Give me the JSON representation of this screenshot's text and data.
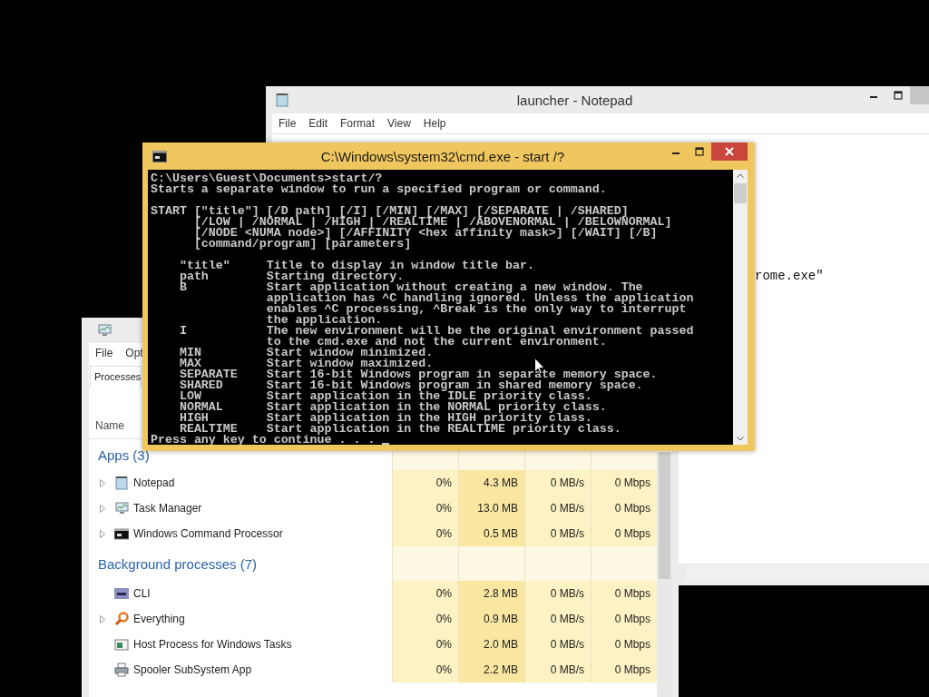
{
  "notepad": {
    "title": "launcher - Notepad",
    "menu": [
      "File",
      "Edit",
      "Format",
      "View",
      "Help"
    ],
    "text": "rome.exe\""
  },
  "task_manager": {
    "menu": [
      "File",
      "Opt"
    ],
    "tabs": [
      {
        "label": "Processes",
        "selected": true
      }
    ],
    "columns": [
      "Name"
    ],
    "groups": [
      {
        "title": "Apps (3)",
        "rows": [
          {
            "name": "Notepad",
            "kind": "notepad",
            "expandable": true,
            "cpu": "0%",
            "memory": "4.3 MB",
            "disk": "0 MB/s",
            "network": "0 Mbps"
          },
          {
            "name": "Task Manager",
            "kind": "monitor",
            "expandable": true,
            "cpu": "0%",
            "memory": "13.0 MB",
            "disk": "0 MB/s",
            "network": "0 Mbps"
          },
          {
            "name": "Windows Command Processor",
            "kind": "console",
            "expandable": true,
            "cpu": "0%",
            "memory": "0.5 MB",
            "disk": "0 MB/s",
            "network": "0 Mbps"
          }
        ]
      },
      {
        "title": "Background processes (7)",
        "rows": [
          {
            "name": "CLI",
            "kind": "php",
            "expandable": false,
            "cpu": "0%",
            "memory": "2.8 MB",
            "disk": "0 MB/s",
            "network": "0 Mbps"
          },
          {
            "name": "Everything",
            "kind": "magnifier",
            "expandable": true,
            "cpu": "0%",
            "memory": "0.9 MB",
            "disk": "0 MB/s",
            "network": "0 Mbps"
          },
          {
            "name": "Host Process for Windows Tasks",
            "kind": "window",
            "expandable": false,
            "cpu": "0%",
            "memory": "2.0 MB",
            "disk": "0 MB/s",
            "network": "0 Mbps"
          },
          {
            "name": "Spooler SubSystem App",
            "kind": "printer",
            "expandable": false,
            "cpu": "0%",
            "memory": "2.2 MB",
            "disk": "0 MB/s",
            "network": "0 Mbps"
          }
        ]
      }
    ]
  },
  "cmd": {
    "title": "C:\\Windows\\system32\\cmd.exe - start /?",
    "blocks": [
      [
        "C:\\Users\\Guest\\Documents>start/?",
        "Starts a separate window to run a specified program or command."
      ],
      [
        "START [\"title\"] [/D path] [/I] [/MIN] [/MAX] [/SEPARATE | /SHARED]",
        "      [/LOW | /NORMAL | /HIGH | /REALTIME | /ABOVENORMAL | /BELOWNORMAL]",
        "      [/NODE <NUMA node>] [/AFFINITY <hex affinity mask>] [/WAIT] [/B]",
        "      [command/program] [parameters]"
      ],
      [
        "    \"title\"     Title to display in window title bar.",
        "    path        Starting directory.",
        "    B           Start application without creating a new window. The",
        "                application has ^C handling ignored. Unless the application",
        "                enables ^C processing, ^Break is the only way to interrupt",
        "                the application.",
        "    I           The new environment will be the original environment passed",
        "                to the cmd.exe and not the current environment.",
        "    MIN         Start window minimized.",
        "    MAX         Start window maximized.",
        "    SEPARATE    Start 16-bit Windows program in separate memory space.",
        "    SHARED      Start 16-bit Windows program in shared memory space.",
        "    LOW         Start application in the IDLE priority class.",
        "    NORMAL      Start application in the NORMAL priority class.",
        "    HIGH        Start application in the HIGH priority class.",
        "    REALTIME    Start application in the REALTIME priority class.",
        "Press any key to continue . . ."
      ]
    ]
  }
}
